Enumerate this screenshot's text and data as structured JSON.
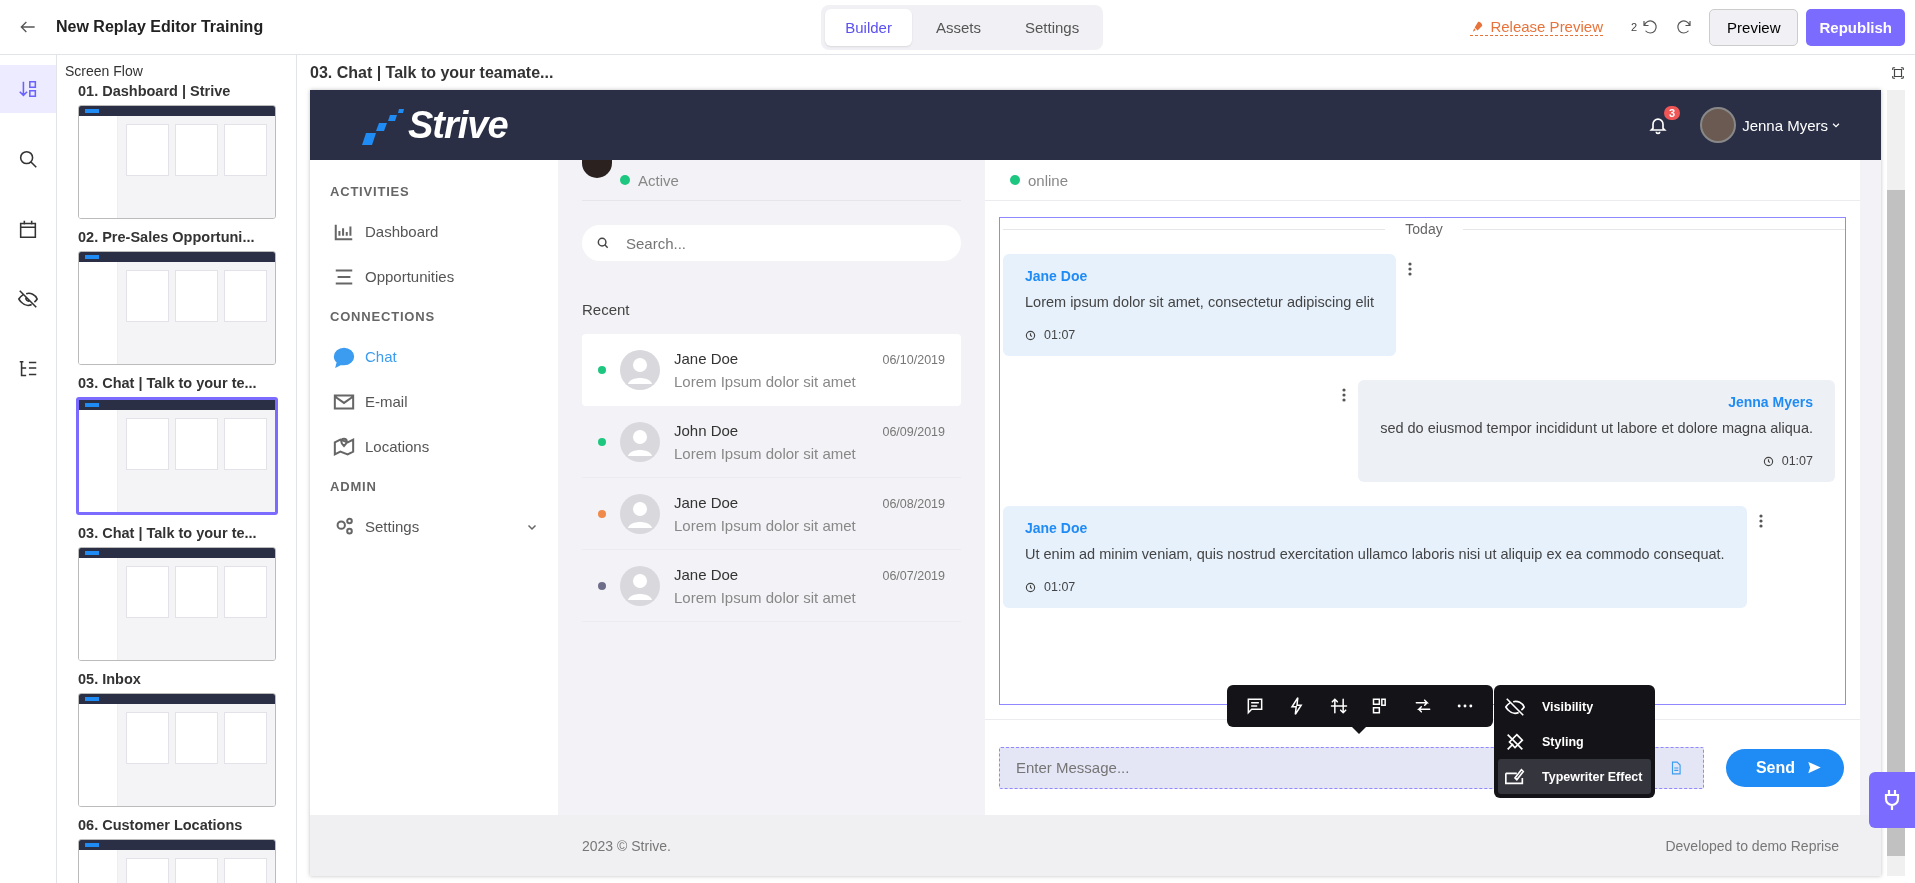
{
  "topbar": {
    "title": "New Replay Editor Training",
    "tabs": [
      {
        "label": "Builder",
        "selected": true
      },
      {
        "label": "Assets",
        "selected": false
      },
      {
        "label": "Settings",
        "selected": false
      }
    ],
    "release_preview": "Release Preview",
    "undo_count": "2",
    "preview": "Preview",
    "republish": "Republish"
  },
  "rail": [
    {
      "selected": true
    },
    {
      "selected": false
    },
    {
      "selected": false
    },
    {
      "selected": false
    },
    {
      "selected": false
    }
  ],
  "screen_flow": {
    "title": "Screen Flow",
    "screens": [
      {
        "label": "01. Dashboard | Strive",
        "selected": false
      },
      {
        "label": "02. Pre-Sales Opportuni...",
        "selected": false
      },
      {
        "label": "03. Chat | Talk to your te...",
        "selected": true
      },
      {
        "label": "03. Chat | Talk to your te...",
        "selected": false
      },
      {
        "label": "05. Inbox",
        "selected": false
      },
      {
        "label": "06. Customer Locations",
        "selected": false
      }
    ]
  },
  "canvas": {
    "title": "03. Chat | Talk to your teamate..."
  },
  "app": {
    "brand": "Strive",
    "notifications": "3",
    "user": "Jenna Myers",
    "nav": [
      {
        "kind": "section",
        "label": "ACTIVITIES"
      },
      {
        "kind": "item",
        "label": "Dashboard",
        "selected": false
      },
      {
        "kind": "item",
        "label": "Opportunities",
        "selected": false
      },
      {
        "kind": "section",
        "label": "CONNECTIONS"
      },
      {
        "kind": "item",
        "label": "Chat",
        "selected": true
      },
      {
        "kind": "item",
        "label": "E-mail",
        "selected": false
      },
      {
        "kind": "item",
        "label": "Locations",
        "selected": false
      },
      {
        "kind": "section",
        "label": "ADMIN"
      },
      {
        "kind": "item",
        "label": "Settings",
        "selected": false
      }
    ],
    "profile_status": "Active",
    "search_placeholder": "Search...",
    "recent_title": "Recent",
    "contacts": [
      {
        "name": "Jane Doe",
        "date": "06/10/2019",
        "preview": "Lorem Ipsum dolor sit amet",
        "color": "#1ec77f",
        "selected": true
      },
      {
        "name": "John Doe",
        "date": "06/09/2019",
        "preview": "Lorem Ipsum dolor sit amet",
        "color": "#1ec77f",
        "selected": false
      },
      {
        "name": "Jane Doe",
        "date": "06/08/2019",
        "preview": "Lorem Ipsum dolor sit amet",
        "color": "#f0894a",
        "selected": false
      },
      {
        "name": "Jane Doe",
        "date": "06/07/2019",
        "preview": "Lorem Ipsum dolor sit amet",
        "color": "#6e6e8a",
        "selected": false
      }
    ],
    "chat_status": "online",
    "day_label": "Today",
    "messages": [
      {
        "kind": "incoming",
        "author": "Jane Doe",
        "text": "Lorem ipsum dolor sit amet, consectetur adipiscing elit",
        "time": "01:07"
      },
      {
        "kind": "outgoing",
        "author": "Jenna Myers",
        "text": "sed do eiusmod tempor incididunt ut labore et dolore magna aliqua.",
        "time": "01:07"
      },
      {
        "kind": "incoming",
        "author": "Jane Doe",
        "text": "Ut enim ad minim veniam, quis nostrud exercitation ullamco laboris nisi ut aliquip ex ea commodo consequat.",
        "time": "01:07"
      }
    ],
    "message_placeholder": "Enter Message...",
    "send": "Send",
    "footer_left": "2023 © Strive.",
    "footer_right": "Developed to demo Reprise"
  },
  "menu": [
    {
      "label": "Visibility",
      "selected": false
    },
    {
      "label": "Styling",
      "selected": false
    },
    {
      "label": "Typewriter Effect",
      "selected": true
    }
  ]
}
